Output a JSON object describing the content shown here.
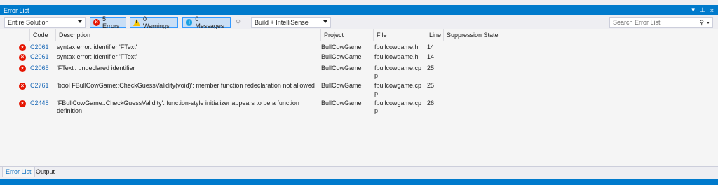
{
  "window": {
    "title": "Error List",
    "controls": [
      "▾",
      "⊥",
      "×"
    ]
  },
  "toolbar": {
    "scope_value": "Entire Solution",
    "errors_label": "5 Errors",
    "warnings_label": "0 Warnings",
    "messages_label": "0 Messages",
    "build_value": "Build + IntelliSense",
    "search_placeholder": "Search Error List"
  },
  "columns": [
    "Code",
    "Description",
    "Project",
    "File",
    "Line",
    "Suppression State"
  ],
  "rows": [
    {
      "code": "C2061",
      "description": [
        "syntax error: identifier 'FText'"
      ],
      "project": "BullCowGame",
      "file": [
        "fbullcowgame.h"
      ],
      "line": "14"
    },
    {
      "code": "C2061",
      "description": [
        "syntax error: identifier 'FText'"
      ],
      "project": "BullCowGame",
      "file": [
        "fbullcowgame.h"
      ],
      "line": "14"
    },
    {
      "code": "C2065",
      "description": [
        "'FText': undeclared identifier"
      ],
      "project": "BullCowGame",
      "file": [
        "fbullcowgame.cp",
        "p"
      ],
      "line": "25"
    },
    {
      "code": "C2761",
      "description": [
        "'bool FBullCowGame::CheckGuessValidity(void)': member function redeclaration not allowed"
      ],
      "project": "BullCowGame",
      "file": [
        "fbullcowgame.cp",
        "p"
      ],
      "line": "25"
    },
    {
      "code": "C2448",
      "description": [
        "'FBullCowGame::CheckGuessValidity': function-style initializer appears to be a function",
        "definition"
      ],
      "project": "BullCowGame",
      "file": [
        "fbullcowgame.cp",
        "p"
      ],
      "line": "26"
    }
  ],
  "tabs": [
    "Error List",
    "Output"
  ],
  "colors": {
    "accent": "#007acc",
    "error": "#e51400",
    "link": "#1e6bb8"
  }
}
